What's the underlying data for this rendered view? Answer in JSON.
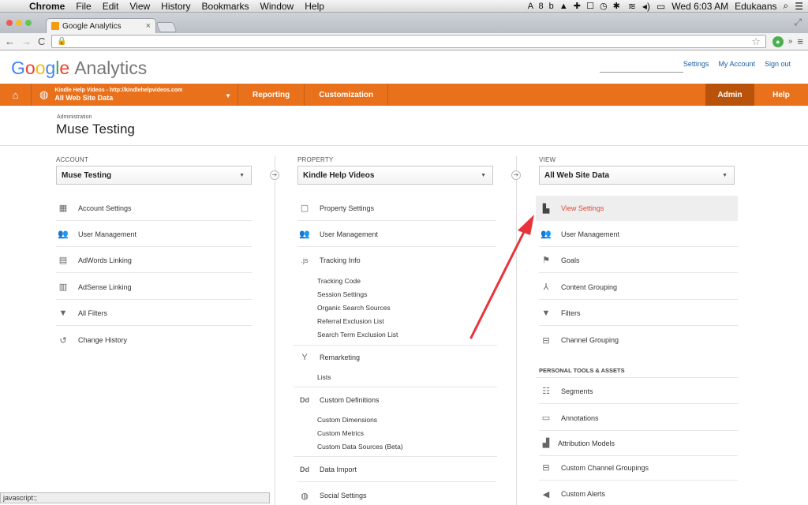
{
  "mac": {
    "menu": [
      "Chrome",
      "File",
      "Edit",
      "View",
      "History",
      "Bookmarks",
      "Window",
      "Help"
    ],
    "tray_icons": "A 8  b  ▲  ✚  ☐  ◷  ✱",
    "clock": "Wed 6:03 AM",
    "user": "Edukaans"
  },
  "browser": {
    "tab_title": "Google Analytics",
    "url": ""
  },
  "ga": {
    "logo_google": [
      "G",
      "o",
      "o",
      "g",
      "l",
      "e"
    ],
    "logo_product": "Analytics",
    "top_links": [
      "Settings",
      "My Account",
      "Sign out"
    ],
    "nav": {
      "account_line1": "Kindle Help Videos - http://kindlehelpvideos.com",
      "account_line2": "All Web Site Data",
      "reporting": "Reporting",
      "customization": "Customization",
      "admin": "Admin",
      "help": "Help"
    },
    "breadcrumb": "Administration",
    "page_title": "Muse Testing"
  },
  "account": {
    "label": "ACCOUNT",
    "selected": "Muse Testing",
    "items": [
      {
        "icon": "building-icon",
        "label": "Account Settings"
      },
      {
        "icon": "users-icon",
        "label": "User Management"
      },
      {
        "icon": "adwords-icon",
        "label": "AdWords Linking"
      },
      {
        "icon": "adsense-icon",
        "label": "AdSense Linking"
      },
      {
        "icon": "filter-icon",
        "label": "All Filters"
      },
      {
        "icon": "history-icon",
        "label": "Change History"
      }
    ]
  },
  "property": {
    "label": "PROPERTY",
    "selected": "Kindle Help Videos",
    "property_settings": "Property Settings",
    "user_management": "User Management",
    "tracking_info": "Tracking Info",
    "tracking_subs": [
      "Tracking Code",
      "Session Settings",
      "Organic Search Sources",
      "Referral Exclusion List",
      "Search Term Exclusion List"
    ],
    "remarketing": "Remarketing",
    "remarketing_subs": [
      "Lists"
    ],
    "custom_definitions": "Custom Definitions",
    "custom_subs": [
      "Custom Dimensions",
      "Custom Metrics",
      "Custom Data Sources (Beta)"
    ],
    "data_import": "Data Import",
    "social_settings": "Social Settings"
  },
  "view": {
    "label": "VIEW",
    "selected": "All Web Site Data",
    "items": [
      {
        "icon": "document-icon",
        "label": "View Settings"
      },
      {
        "icon": "users-icon",
        "label": "User Management"
      },
      {
        "icon": "flag-icon",
        "label": "Goals"
      },
      {
        "icon": "grouping-icon",
        "label": "Content Grouping"
      },
      {
        "icon": "filter-icon",
        "label": "Filters"
      },
      {
        "icon": "channel-icon",
        "label": "Channel Grouping"
      }
    ],
    "personal_header": "PERSONAL TOOLS & ASSETS",
    "personal_items": [
      {
        "icon": "segments-icon",
        "label": "Segments"
      },
      {
        "icon": "annotation-icon",
        "label": "Annotations"
      },
      {
        "icon": "attribution-icon",
        "label": "Attribution Models"
      },
      {
        "icon": "channel-icon",
        "label": "Custom Channel Groupings"
      },
      {
        "icon": "megaphone-icon",
        "label": "Custom Alerts"
      }
    ]
  },
  "status_bar": "javascript:;",
  "colors": {
    "nav_orange": "#e9711c",
    "admin_dark": "#b9530c",
    "active_red": "#dd4b39",
    "annotation_arrow": "#e8333a"
  }
}
